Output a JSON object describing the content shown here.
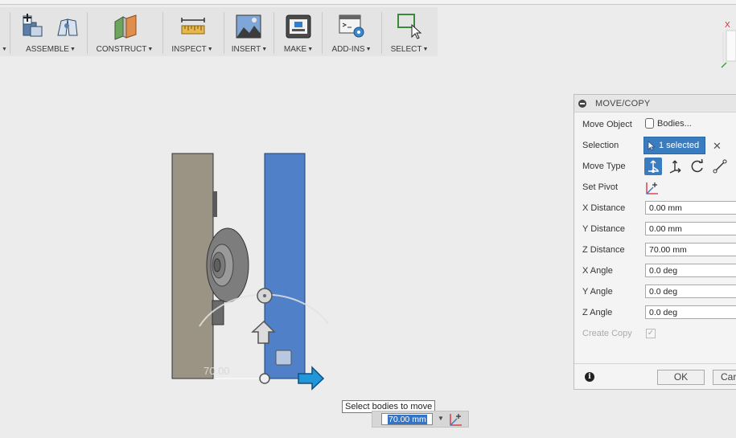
{
  "toolbar": {
    "groups": [
      {
        "label": "ASSEMBLE",
        "icon": "assemble-icon"
      },
      {
        "label": "CONSTRUCT",
        "icon": "construct-plane-icon"
      },
      {
        "label": "INSPECT",
        "icon": "measure-ruler-icon"
      },
      {
        "label": "INSERT",
        "icon": "insert-image-icon"
      },
      {
        "label": "MAKE",
        "icon": "make-3d-print-icon"
      },
      {
        "label": "ADD-INS",
        "icon": "scripts-addins-icon"
      },
      {
        "label": "SELECT",
        "icon": "select-window-icon"
      }
    ]
  },
  "viewport": {
    "dimension_label": "70.00",
    "colors": {
      "body_gray": "#9b9384",
      "body_blue": "#4f80c8",
      "arrow_blue": "#2196d8"
    }
  },
  "panel": {
    "title": "MOVE/COPY",
    "move_object": {
      "label": "Move Object",
      "value": "Bodies..."
    },
    "selection": {
      "label": "Selection",
      "value": "1 selected"
    },
    "move_type": {
      "label": "Move Type",
      "options": [
        "free-move-icon",
        "translate-icon",
        "rotate-icon",
        "point-to-point-icon"
      ]
    },
    "set_pivot": {
      "label": "Set Pivot"
    },
    "x_distance": {
      "label": "X Distance",
      "value": "0.00 mm"
    },
    "y_distance": {
      "label": "Y Distance",
      "value": "0.00 mm"
    },
    "z_distance": {
      "label": "Z Distance",
      "value": "70.00 mm"
    },
    "x_angle": {
      "label": "X Angle",
      "value": "0.0 deg"
    },
    "y_angle": {
      "label": "Y Angle",
      "value": "0.0 deg"
    },
    "z_angle": {
      "label": "Z Angle",
      "value": "0.0 deg"
    },
    "create_copy": {
      "label": "Create Copy",
      "checked": true
    },
    "ok": "OK",
    "cancel": "Car"
  },
  "tooltip": "Select bodies to move",
  "distance_input": {
    "value": "70.00 mm"
  }
}
